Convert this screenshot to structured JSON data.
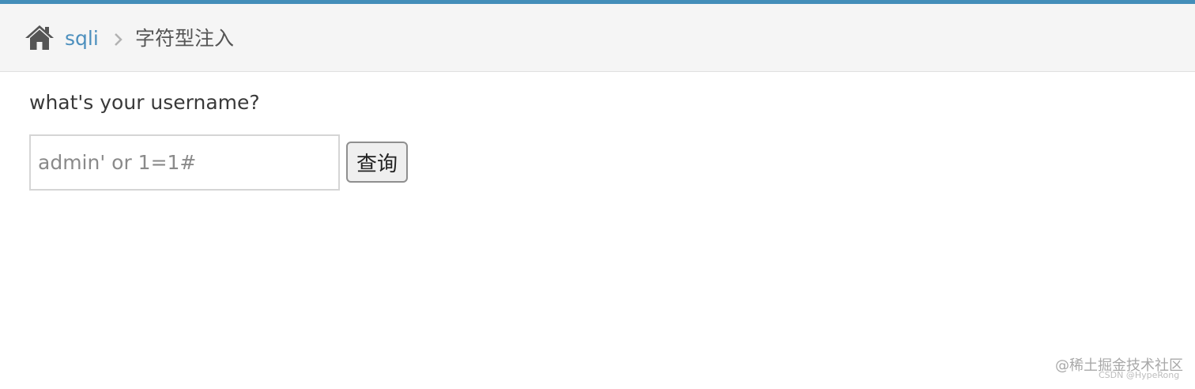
{
  "header": {
    "accent_color": "#438eb9",
    "home_icon": "home-icon",
    "separator_icon": "chevron-right-icon"
  },
  "breadcrumb": {
    "link_label": "sqli",
    "current_label": "字符型注入",
    "link_color": "#4c8fbd"
  },
  "form": {
    "question": "what's your username?",
    "input_value": "",
    "input_placeholder": "admin' or 1=1#",
    "submit_label": "查询"
  },
  "watermark": {
    "main": "@稀土掘金技术社区",
    "sub": "CSDN @HypeRong"
  }
}
